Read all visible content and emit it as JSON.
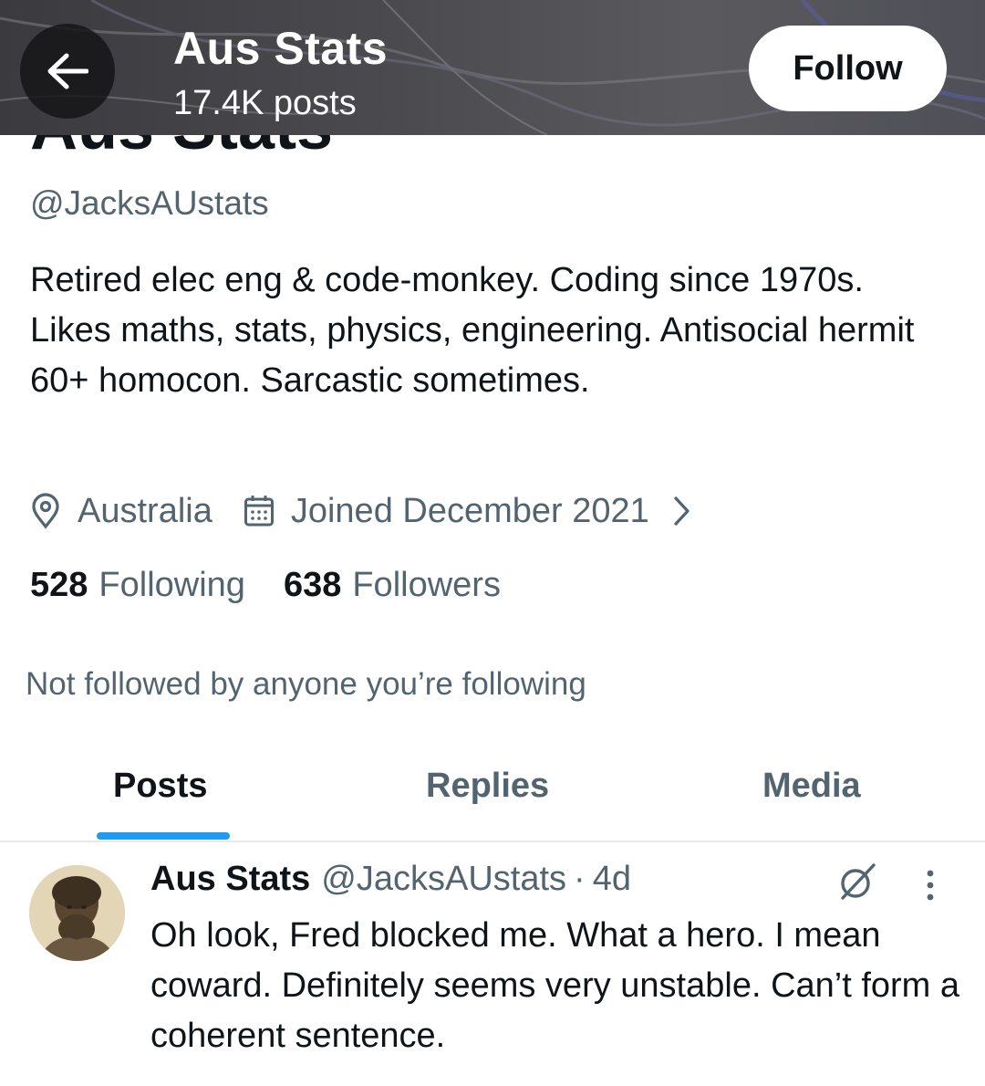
{
  "header": {
    "title": "Aus Stats",
    "posts_count": "17.4K posts",
    "follow_label": "Follow",
    "back_icon": "back-arrow-icon"
  },
  "profile": {
    "name": "Aus Stats",
    "handle": "@JacksAUstats",
    "bio": "Retired elec eng & code-monkey. Coding since 1970s. Likes maths, stats, physics, engineering. Antisocial hermit 60+ homocon. Sarcastic sometimes.",
    "location": "Australia",
    "joined": "Joined December 2021",
    "following_count": "528",
    "following_label": "Following",
    "followers_count": "638",
    "followers_label": "Followers",
    "not_followed_text": "Not followed by anyone you’re following"
  },
  "tabs": [
    {
      "label": "Posts",
      "active": true
    },
    {
      "label": "Replies",
      "active": false
    },
    {
      "label": "Media",
      "active": false
    }
  ],
  "post": {
    "author": "Aus Stats",
    "handle": "@JacksAUstats",
    "separator": "·",
    "time": "4d",
    "text": "Oh look, Fred blocked me. What a hero. I mean coward. Definitely seems very unstable. Can’t form a coherent sentence."
  },
  "colors": {
    "accent": "#1d9bf0",
    "text": "#0f1419",
    "secondary": "#536471"
  }
}
